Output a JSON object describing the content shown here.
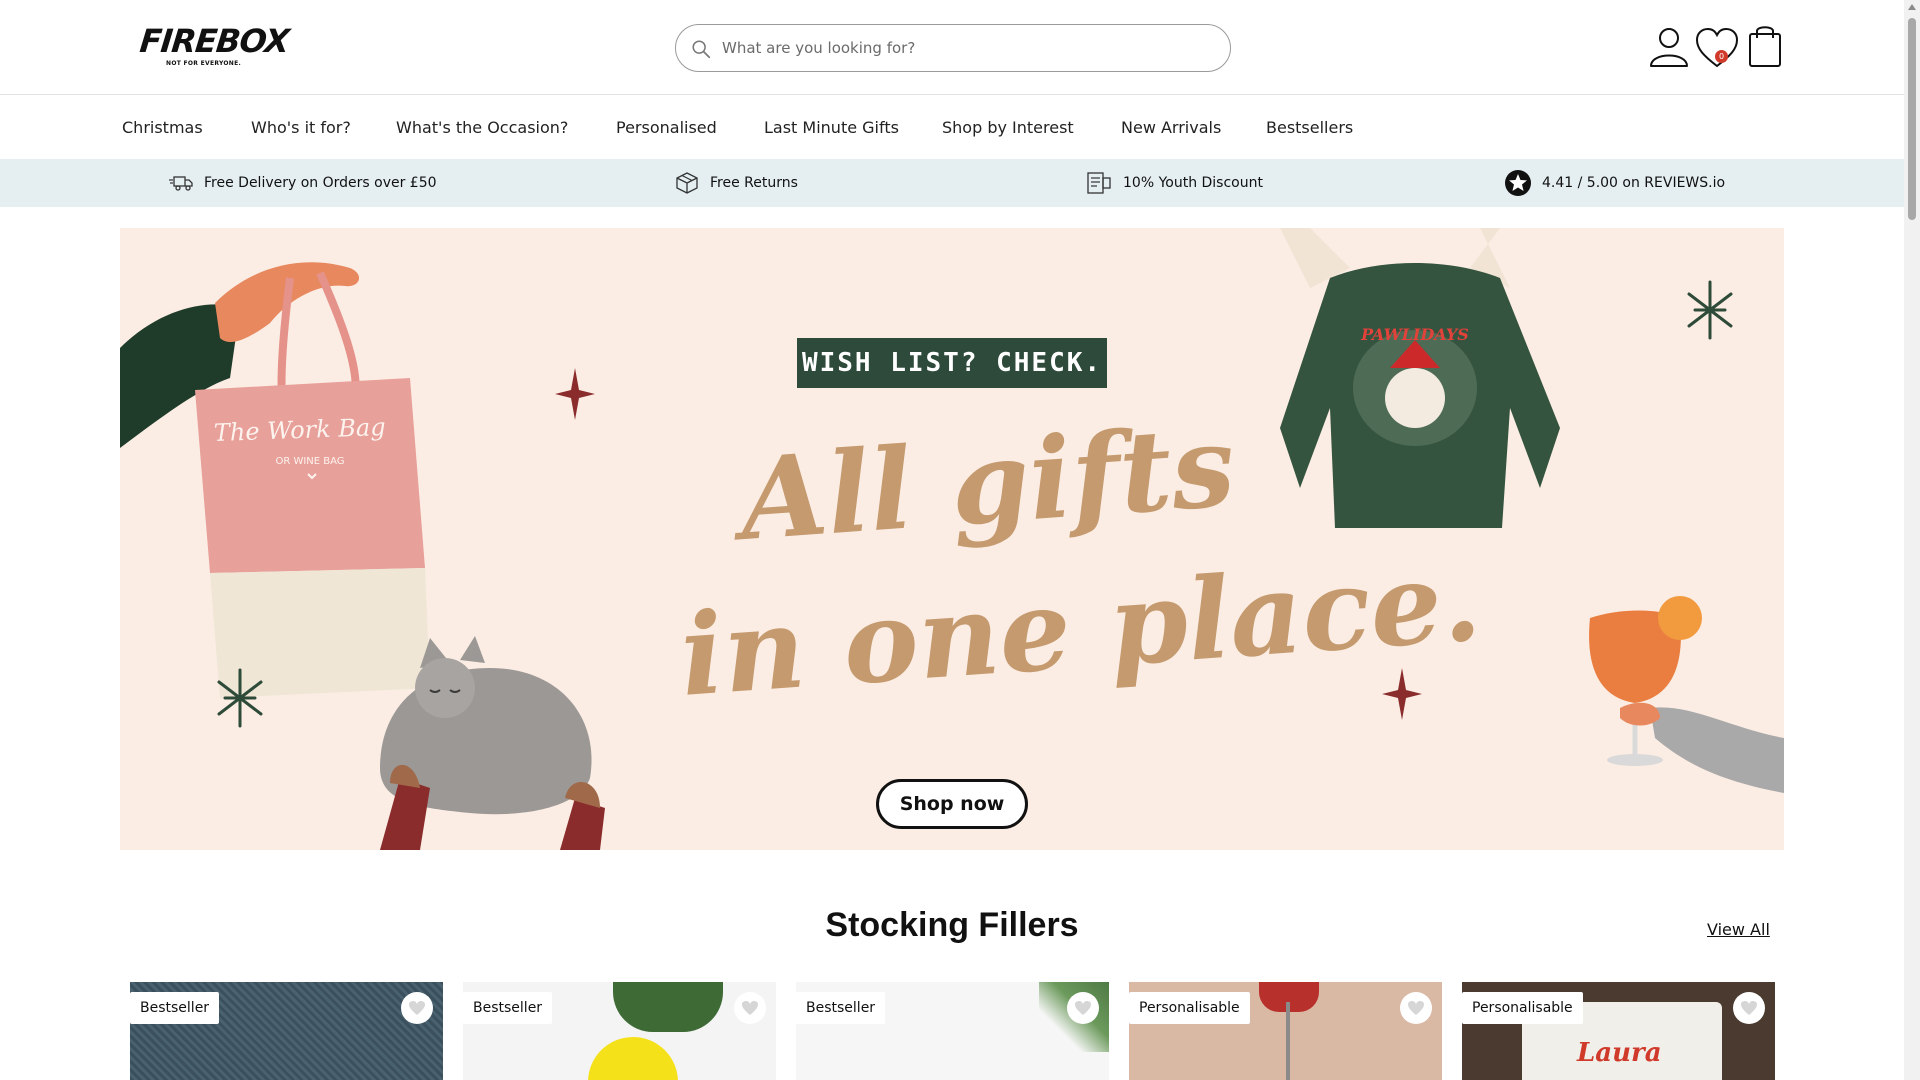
{
  "header": {
    "logo": {
      "word": "FIREBOX",
      "tagline": "NOT FOR EVERYONE."
    },
    "search": {
      "placeholder": "What are you looking for?"
    },
    "wishlist_count": "0",
    "icons": [
      "account-icon",
      "wishlist-heart-icon",
      "shopping-bag-icon",
      "search-icon"
    ]
  },
  "nav": {
    "items": [
      {
        "label": "Christmas"
      },
      {
        "label": "Who's it for?"
      },
      {
        "label": "What's the Occasion?"
      },
      {
        "label": "Personalised"
      },
      {
        "label": "Last Minute Gifts"
      },
      {
        "label": "Shop by Interest"
      },
      {
        "label": "New Arrivals"
      },
      {
        "label": "Bestsellers"
      }
    ]
  },
  "usp": {
    "items": [
      {
        "icon": "delivery-truck-icon",
        "label": "Free Delivery on Orders over £50"
      },
      {
        "icon": "returns-box-icon",
        "label": "Free Returns"
      },
      {
        "icon": "discount-card-icon",
        "label": "10% Youth Discount"
      },
      {
        "icon": "star-badge-icon",
        "label": "4.41 / 5.00 on REVIEWS.io"
      }
    ]
  },
  "hero": {
    "banner_label": "WISH LIST? CHECK.",
    "headline_line1": "All gifts",
    "headline_line2": "in one place.",
    "bag_text": "The Work Bag",
    "bag_subtext": "OR WINE BAG",
    "sweater_text": "PAWLIDAYS",
    "cta": "Shop now",
    "colors": {
      "background": "#fbede4",
      "label_bg": "#2d4a3a",
      "script": "#c59a6e"
    }
  },
  "section": {
    "title": "Stocking Fillers",
    "view_all": "View All"
  },
  "products": [
    {
      "badge": "Bestseller"
    },
    {
      "badge": "Bestseller"
    },
    {
      "badge": "Bestseller"
    },
    {
      "badge": "Personalisable"
    },
    {
      "badge": "Personalisable",
      "name_on_image": "Laura"
    }
  ]
}
